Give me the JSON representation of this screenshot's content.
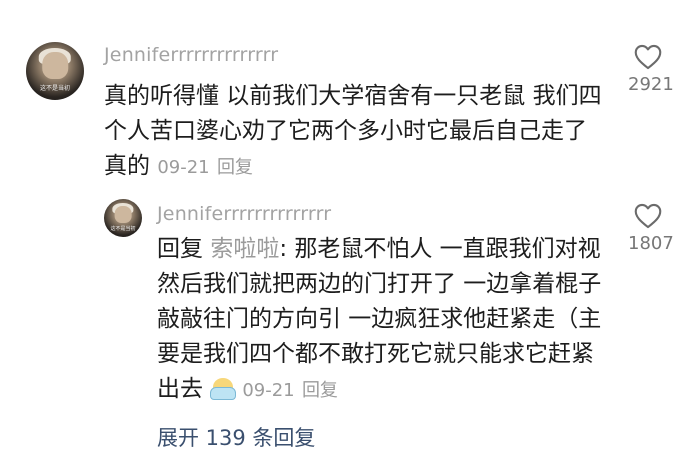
{
  "comment": {
    "avatar_caption": "这不是当初",
    "username": "Jenniferrrrrrrrrrrrrr",
    "text": "真的听得懂 以前我们大学宿舍有一只老鼠 我们四个人苦口婆心劝了它两个多小时它最后自己走了真的",
    "date": "09-21",
    "reply_label": "回复",
    "like_icon": "heart-outline-icon",
    "like_count": "2921"
  },
  "reply": {
    "avatar_caption": "这不是当初",
    "username": "Jenniferrrrrrrrrrrrrr",
    "prefix": "回复",
    "reply_to": "索啦啦",
    "text": ": 那老鼠不怕人 一直跟我们对视然后我们就把两边的门打开了 一边拿着棍子敲敲往门的方向引 一边疯狂求他赶紧走（主要是我们四个都不敢打死它就只能求它赶紧出去",
    "emoji": "face-with-towel-emoji",
    "date": "09-21",
    "reply_label": "回复",
    "like_icon": "heart-outline-icon",
    "like_count": "1807"
  },
  "expand_label": "展开 139 条回复",
  "colors": {
    "username": "#a3a3a3",
    "body_text": "#1d1d1d",
    "meta": "#9b9b9b",
    "expand_link": "#3a4f6e"
  }
}
